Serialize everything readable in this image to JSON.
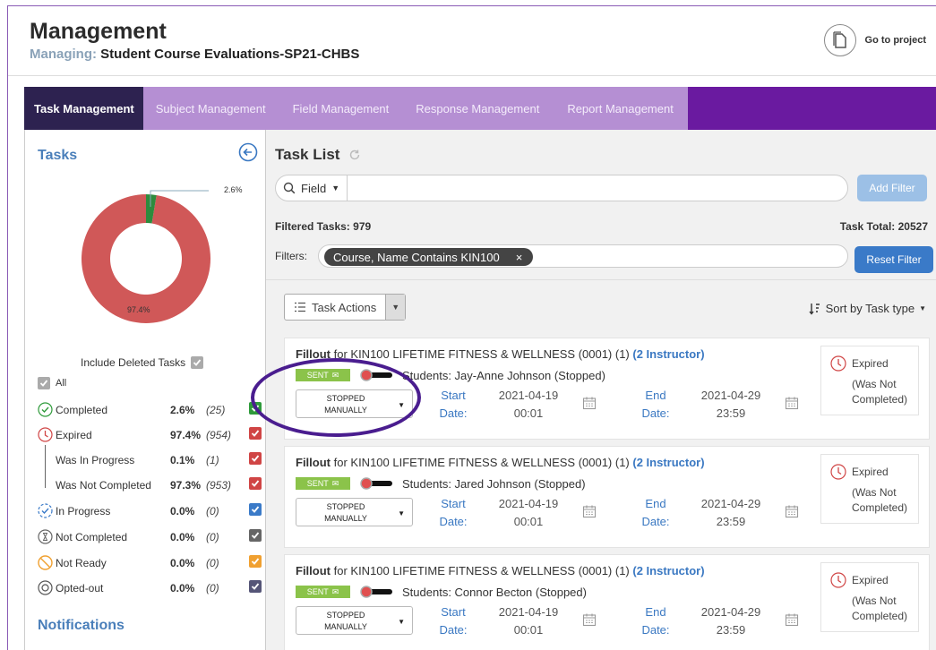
{
  "header": {
    "title": "Management",
    "managing_label": "Managing:",
    "managing_value": "Student Course Evaluations-SP21-CHBS",
    "goto_label": "Go to project"
  },
  "tabs": [
    {
      "label": "Task Management",
      "active": true
    },
    {
      "label": "Subject Management"
    },
    {
      "label": "Field Management"
    },
    {
      "label": "Response Management"
    },
    {
      "label": "Report Management"
    }
  ],
  "left": {
    "title": "Tasks",
    "chart": {
      "completed_label": "2.6%",
      "expired_label": "97.4%",
      "completed_fraction": 0.026,
      "completed_color": "#2e8b3d",
      "expired_color": "#d05858"
    },
    "include_deleted": "Include Deleted Tasks",
    "all_label": "All",
    "stats": [
      {
        "name": "Completed",
        "pct": "2.6%",
        "count": "(25)",
        "icon": "check-circle-icon",
        "color": "#2e9a3a"
      },
      {
        "name": "Expired",
        "pct": "97.4%",
        "count": "(954)",
        "icon": "clock-icon",
        "color": "#d04545"
      },
      {
        "name": "Was In Progress",
        "pct": "0.1%",
        "count": "(1)",
        "color": "#d04545"
      },
      {
        "name": "Was Not Completed",
        "pct": "97.3%",
        "count": "(953)",
        "color": "#d04545"
      },
      {
        "name": "In Progress",
        "pct": "0.0%",
        "count": "(0)",
        "icon": "progress-circle-icon",
        "color": "#3a7ac8"
      },
      {
        "name": "Not Completed",
        "pct": "0.0%",
        "count": "(0)",
        "icon": "hourglass-icon",
        "color": "#666666"
      },
      {
        "name": "Not Ready",
        "pct": "0.0%",
        "count": "(0)",
        "icon": "no-entry-icon",
        "color": "#f0a030"
      },
      {
        "name": "Opted-out",
        "pct": "0.0%",
        "count": "(0)",
        "icon": "opted-out-icon",
        "color": "#555577"
      }
    ],
    "notifications": "Notifications"
  },
  "right": {
    "title": "Task List",
    "field_label": "Field",
    "add_filter": "Add Filter",
    "filtered_tasks": "Filtered Tasks: 979",
    "task_total": "Task Total: 20527",
    "filters_label": "Filters:",
    "filter_chip": "Course, Name Contains KIN100",
    "filter_chip_close": "×",
    "reset_filter": "Reset Filter",
    "task_actions": "Task Actions",
    "sort_by": "Sort by Task type",
    "cards": [
      {
        "title_bold": "Fillout",
        "title_rest": " for KIN100 LIFETIME FITNESS & WELLNESS (0001) (1) ",
        "instructor": "(2 Instructor)",
        "sent": "SENT",
        "students": "Students: Jay-Anne Johnson (Stopped)",
        "stop_line1": "STOPPED",
        "stop_line2": "MANUALLY",
        "start_line1": "Start",
        "start_line2": "Date:",
        "start_date": "2021-04-19",
        "start_time": "00:01",
        "end_line1": "End",
        "end_line2": "Date:",
        "end_date": "2021-04-29",
        "end_time": "23:59",
        "status": "Expired",
        "status_sub1": "(Was Not",
        "status_sub2": "Completed)"
      },
      {
        "title_bold": "Fillout",
        "title_rest": " for KIN100 LIFETIME FITNESS & WELLNESS (0001) (1) ",
        "instructor": "(2 Instructor)",
        "sent": "SENT",
        "students": "Students: Jared Johnson (Stopped)",
        "stop_line1": "STOPPED",
        "stop_line2": "MANUALLY",
        "start_line1": "Start",
        "start_line2": "Date:",
        "start_date": "2021-04-19",
        "start_time": "00:01",
        "end_line1": "End",
        "end_line2": "Date:",
        "end_date": "2021-04-29",
        "end_time": "23:59",
        "status": "Expired",
        "status_sub1": "(Was Not",
        "status_sub2": "Completed)"
      },
      {
        "title_bold": "Fillout",
        "title_rest": " for KIN100 LIFETIME FITNESS & WELLNESS (0001) (1) ",
        "instructor": "(2 Instructor)",
        "sent": "SENT",
        "students": "Students: Connor Becton (Stopped)",
        "stop_line1": "STOPPED",
        "stop_line2": "MANUALLY",
        "start_line1": "Start",
        "start_line2": "Date:",
        "start_date": "2021-04-19",
        "start_time": "00:01",
        "end_line1": "End",
        "end_line2": "Date:",
        "end_date": "2021-04-29",
        "end_time": "23:59",
        "status": "Expired",
        "status_sub1": "(Was Not",
        "status_sub2": "Completed)"
      }
    ]
  }
}
